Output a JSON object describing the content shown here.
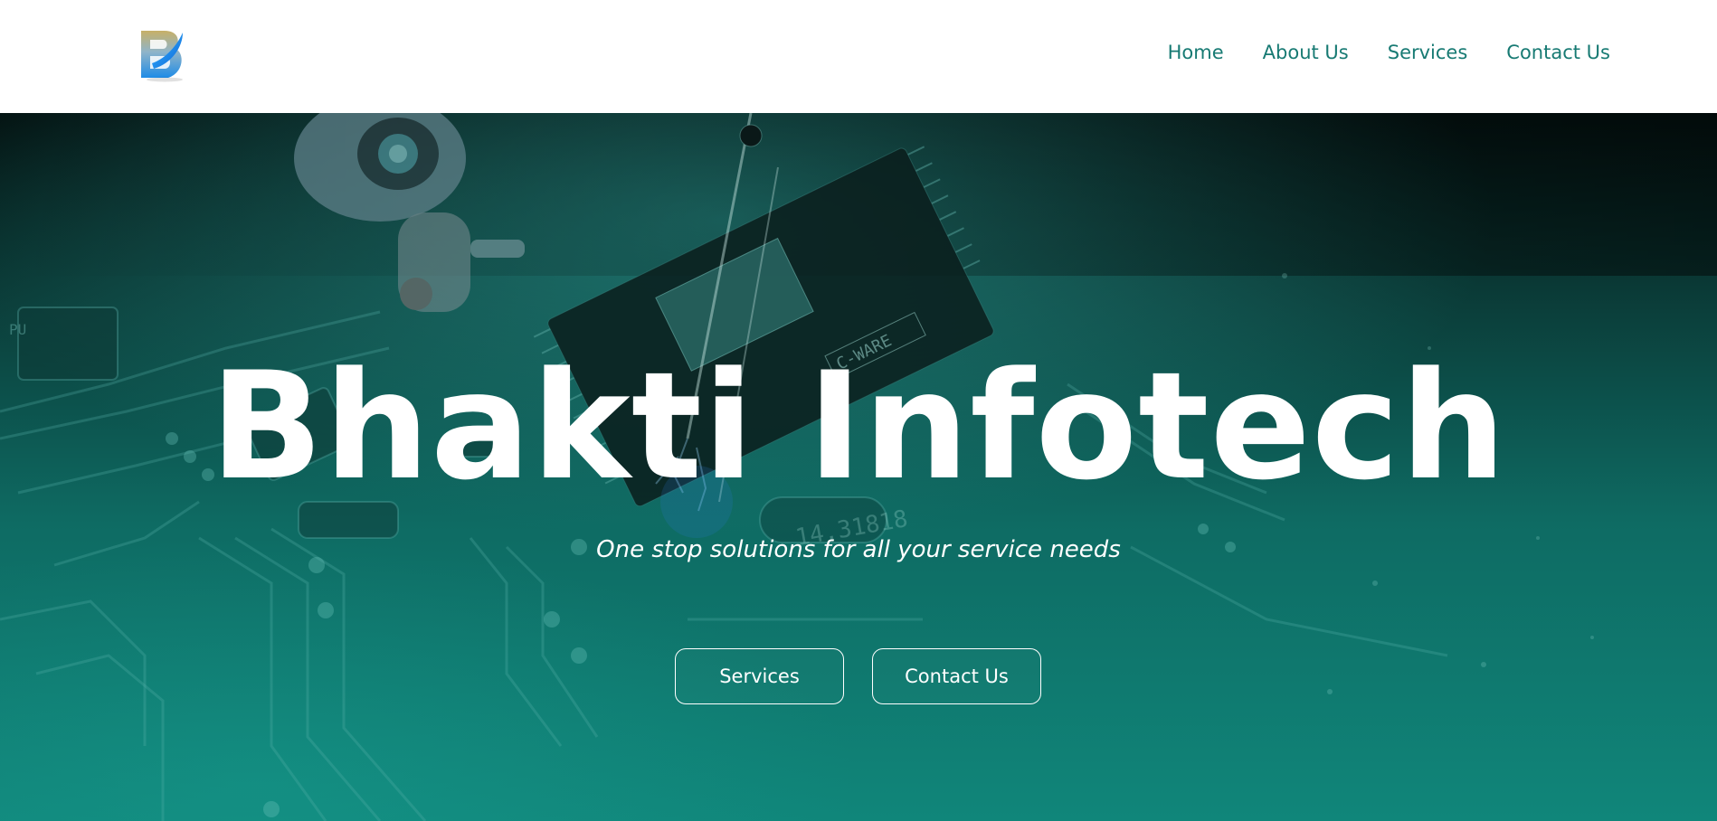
{
  "brand": {
    "logo_letter": "B"
  },
  "nav": {
    "items": [
      {
        "label": "Home"
      },
      {
        "label": "About Us"
      },
      {
        "label": "Services"
      },
      {
        "label": "Contact Us"
      }
    ]
  },
  "hero": {
    "title": "Bhakti Infotech",
    "subtitle": "One stop solutions for all your service needs",
    "buttons": {
      "services": "Services",
      "contact": "Contact Us"
    }
  },
  "background_art_text": {
    "chip_label": "C-WARE",
    "crystal_label": "14.31818",
    "left_label": "PU"
  },
  "colors": {
    "nav_text": "#177a73",
    "hero_dark": "#041312",
    "hero_teal": "#10867a",
    "white": "#ffffff"
  }
}
